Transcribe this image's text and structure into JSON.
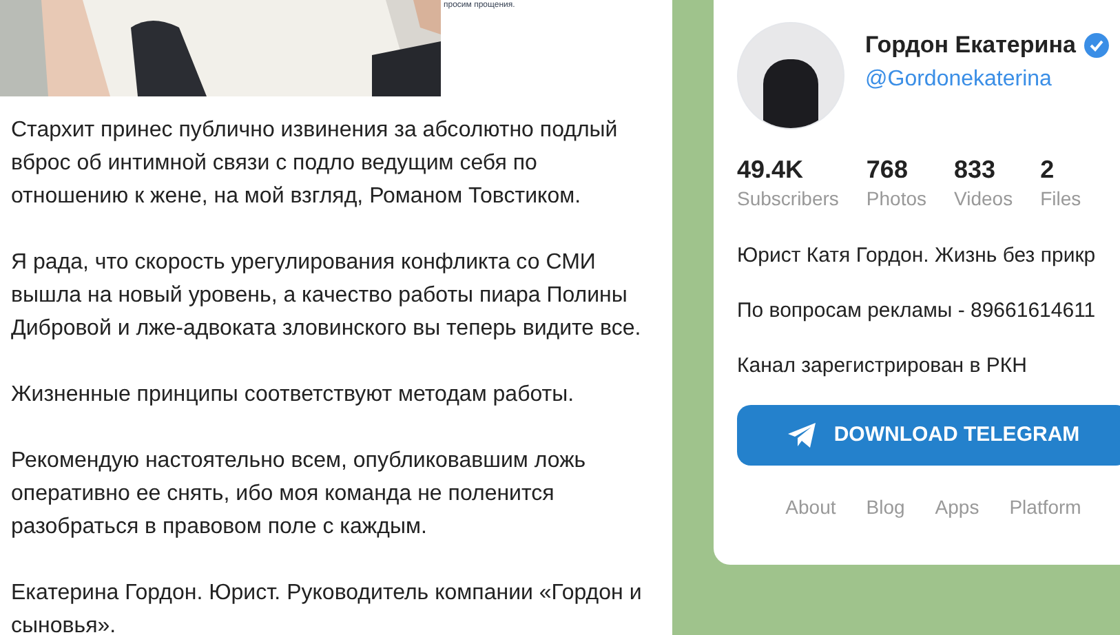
{
  "post": {
    "caption": "просим прощения.",
    "paragraphs": [
      "Стархит принес публично извинения за абсолютно подлый вброс об интимной связи с подло ведущим себя по отношению к жене, на мой взгляд, Романом Товстиком.",
      "Я рада, что скорость урегулирования конфликта со СМИ вышла на новый уровень, а качество работы пиара Полины Дибровой и лже-адвоката зловинского вы теперь видите все.",
      "Жизненные принципы соответствуют методам работы.",
      "Рекомендую настоятельно всем, опубликовавшим ложь оперативно ее снять, ибо моя команда не поленится разобраться в правовом поле с каждым.",
      "Екатерина Гордон. Юрист. Руководитель компании «Гордон и сыновья»."
    ]
  },
  "channel": {
    "name": "Гордон Екатерина",
    "verified": true,
    "username": "@Gordonekaterina",
    "stats": [
      {
        "value": "49.4K",
        "label": "Subscribers"
      },
      {
        "value": "768",
        "label": "Photos"
      },
      {
        "value": "833",
        "label": "Videos"
      },
      {
        "value": "2",
        "label": "Files"
      }
    ],
    "description": [
      "Юрист Катя Гордон. Жизнь без прикр",
      "По вопросам рекламы - 89661614611",
      "Канал зарегистрирован в РКН"
    ],
    "download_button": "DOWNLOAD TELEGRAM",
    "footer_links": [
      "About",
      "Blog",
      "Apps",
      "Platform"
    ]
  }
}
